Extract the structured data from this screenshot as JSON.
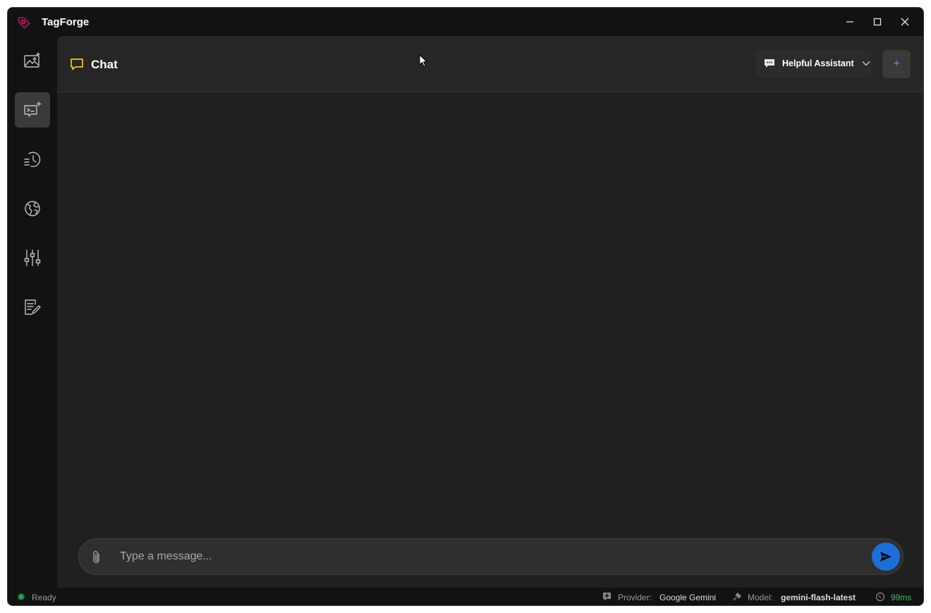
{
  "app": {
    "title": "TagForge"
  },
  "titlebar": {
    "minimize_icon": "minimize-icon",
    "maximize_icon": "maximize-icon",
    "close_icon": "close-icon"
  },
  "sidebar": {
    "items": [
      {
        "name": "image-gallery",
        "icon": "image-sparkle-icon",
        "active": false
      },
      {
        "name": "chat",
        "icon": "chat-sparkle-icon",
        "active": true
      },
      {
        "name": "history",
        "icon": "history-icon",
        "active": false
      },
      {
        "name": "globe",
        "icon": "globe-icon",
        "active": false
      },
      {
        "name": "settings",
        "icon": "sliders-icon",
        "active": false
      },
      {
        "name": "notes",
        "icon": "document-edit-icon",
        "active": false
      }
    ]
  },
  "header": {
    "title": "Chat",
    "title_icon": "chat-icon",
    "assistant_selector": {
      "selected": "Helpful Assistant",
      "icon": "assistant-icon"
    },
    "new_button": "+"
  },
  "composer": {
    "placeholder": "Type a message...",
    "value": "",
    "attach_icon": "paperclip-icon",
    "send_icon": "send-icon"
  },
  "status": {
    "state": "Ready",
    "provider_label": "Provider:",
    "provider_value": "Google Gemini",
    "model_label": "Model:",
    "model_value": "gemini-flash-latest",
    "latency": "99ms"
  },
  "colors": {
    "accent_blue": "#1d6fd8",
    "chat_icon": "#f5c518",
    "ready_green": "#2fa84f",
    "latency_green": "#3fbf5f",
    "brand": "#b0124a"
  }
}
